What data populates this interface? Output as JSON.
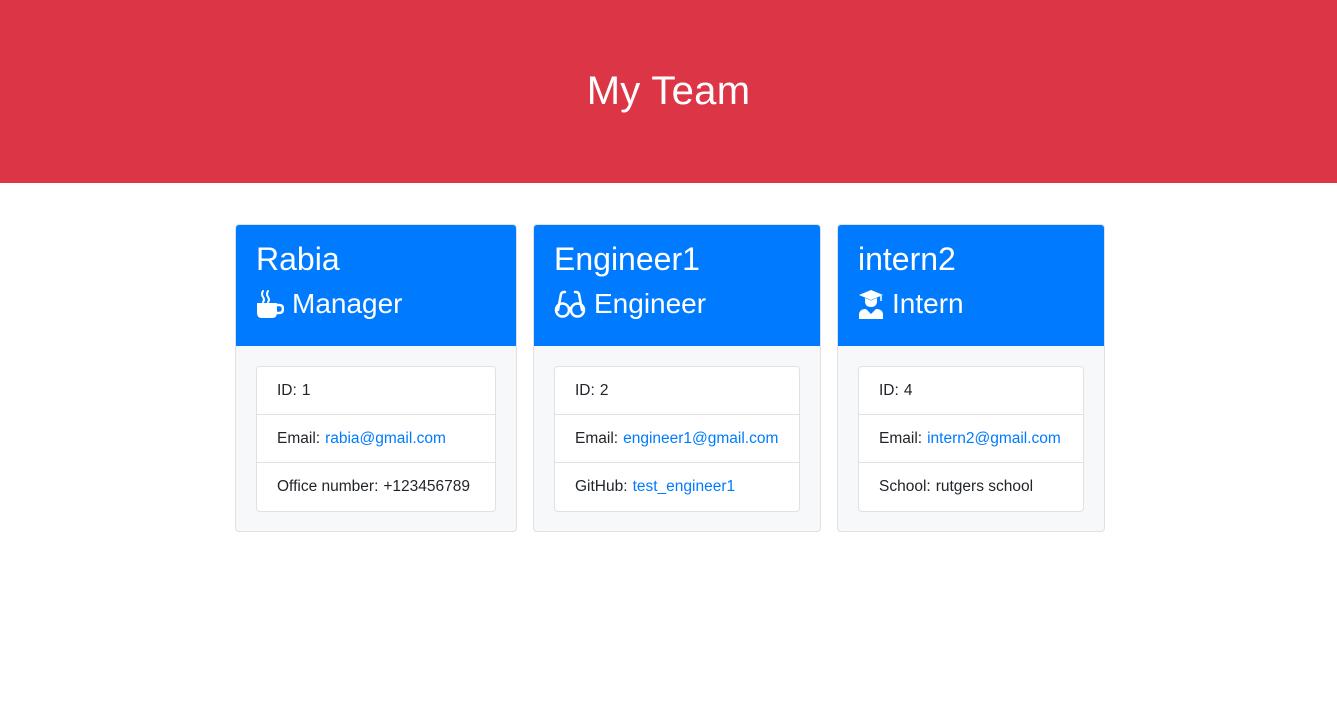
{
  "header": {
    "title": "My Team"
  },
  "colors": {
    "header_bg": "#dc3545",
    "card_header_bg": "#007bff",
    "link": "#007bff"
  },
  "cards": [
    {
      "name": "Rabia",
      "role": "Manager",
      "icon": "mug-icon",
      "id_label": "ID:",
      "id_value": "1",
      "email_label": "Email:",
      "email_value": "rabia@gmail.com",
      "extra_label": "Office number:",
      "extra_value": "+123456789"
    },
    {
      "name": "Engineer1",
      "role": "Engineer",
      "icon": "glasses-icon",
      "id_label": "ID:",
      "id_value": "2",
      "email_label": "Email:",
      "email_value": "engineer1@gmail.com",
      "extra_label": "GitHub:",
      "extra_value": "test_engineer1"
    },
    {
      "name": "intern2",
      "role": "Intern",
      "icon": "graduate-icon",
      "id_label": "ID:",
      "id_value": "4",
      "email_label": "Email:",
      "email_value": "intern2@gmail.com",
      "extra_label": "School:",
      "extra_value": "rutgers school"
    }
  ]
}
